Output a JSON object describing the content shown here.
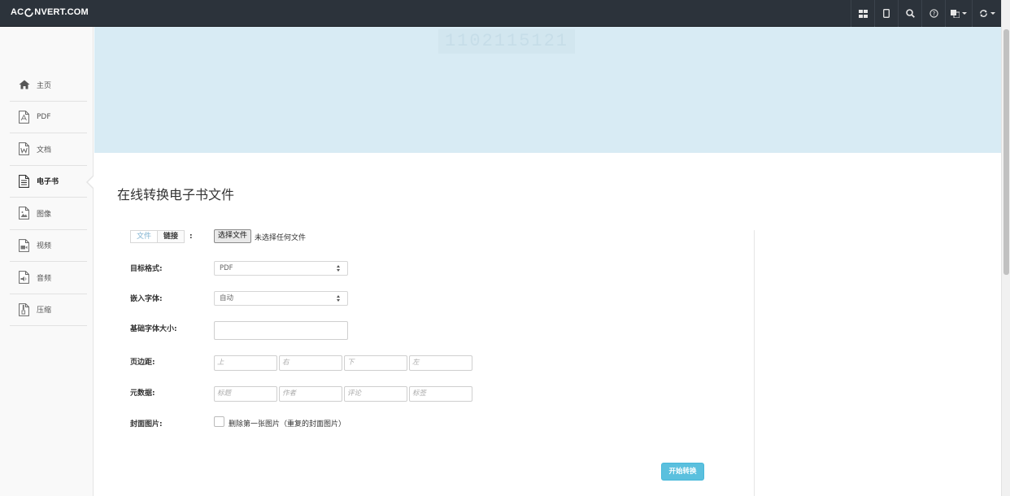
{
  "header": {
    "logo": {
      "prefix": "AC",
      "suffix": "NVERT.COM"
    },
    "icons": [
      "grid-icon",
      "mobile-icon",
      "search-icon",
      "help-icon",
      "language-icon",
      "refresh-icon"
    ]
  },
  "sidebar": {
    "items": [
      {
        "label": "主页",
        "icon": "home-icon",
        "active": false
      },
      {
        "label": "PDF",
        "icon": "pdf-file-icon",
        "active": false
      },
      {
        "label": "文档",
        "icon": "word-file-icon",
        "active": false
      },
      {
        "label": "电子书",
        "icon": "ebook-file-icon",
        "active": true
      },
      {
        "label": "图像",
        "icon": "image-file-icon",
        "active": false
      },
      {
        "label": "视频",
        "icon": "video-file-icon",
        "active": false
      },
      {
        "label": "音频",
        "icon": "audio-file-icon",
        "active": false
      },
      {
        "label": "压缩",
        "icon": "archive-file-icon",
        "active": false
      }
    ]
  },
  "banner": {
    "ghost_text": "1102115121"
  },
  "page": {
    "title": "在线转换电子书文件"
  },
  "form": {
    "source": {
      "tab_file": "文件",
      "tab_link": "链接",
      "colon": ":"
    },
    "file_button": "选择文件",
    "file_none": "未选择任何文件",
    "target_format": {
      "label": "目标格式:",
      "value": "PDF"
    },
    "embed_font": {
      "label": "嵌入字体:",
      "value": "自动"
    },
    "base_font_size": {
      "label": "基础字体大小:",
      "value": ""
    },
    "margins": {
      "label": "页边距:",
      "placeholders": [
        "上",
        "右",
        "下",
        "左"
      ]
    },
    "metadata": {
      "label": "元数据:",
      "placeholders": [
        "标题",
        "作者",
        "评论",
        "标签"
      ]
    },
    "cover": {
      "label": "封面图片:",
      "checkbox_label": "删除第一张图片（重复的封面图片）",
      "checked": false
    },
    "submit": "开始转换"
  },
  "colors": {
    "topbar": "#2c333b",
    "banner": "#d8ebf4",
    "accent": "#5bc0de"
  }
}
